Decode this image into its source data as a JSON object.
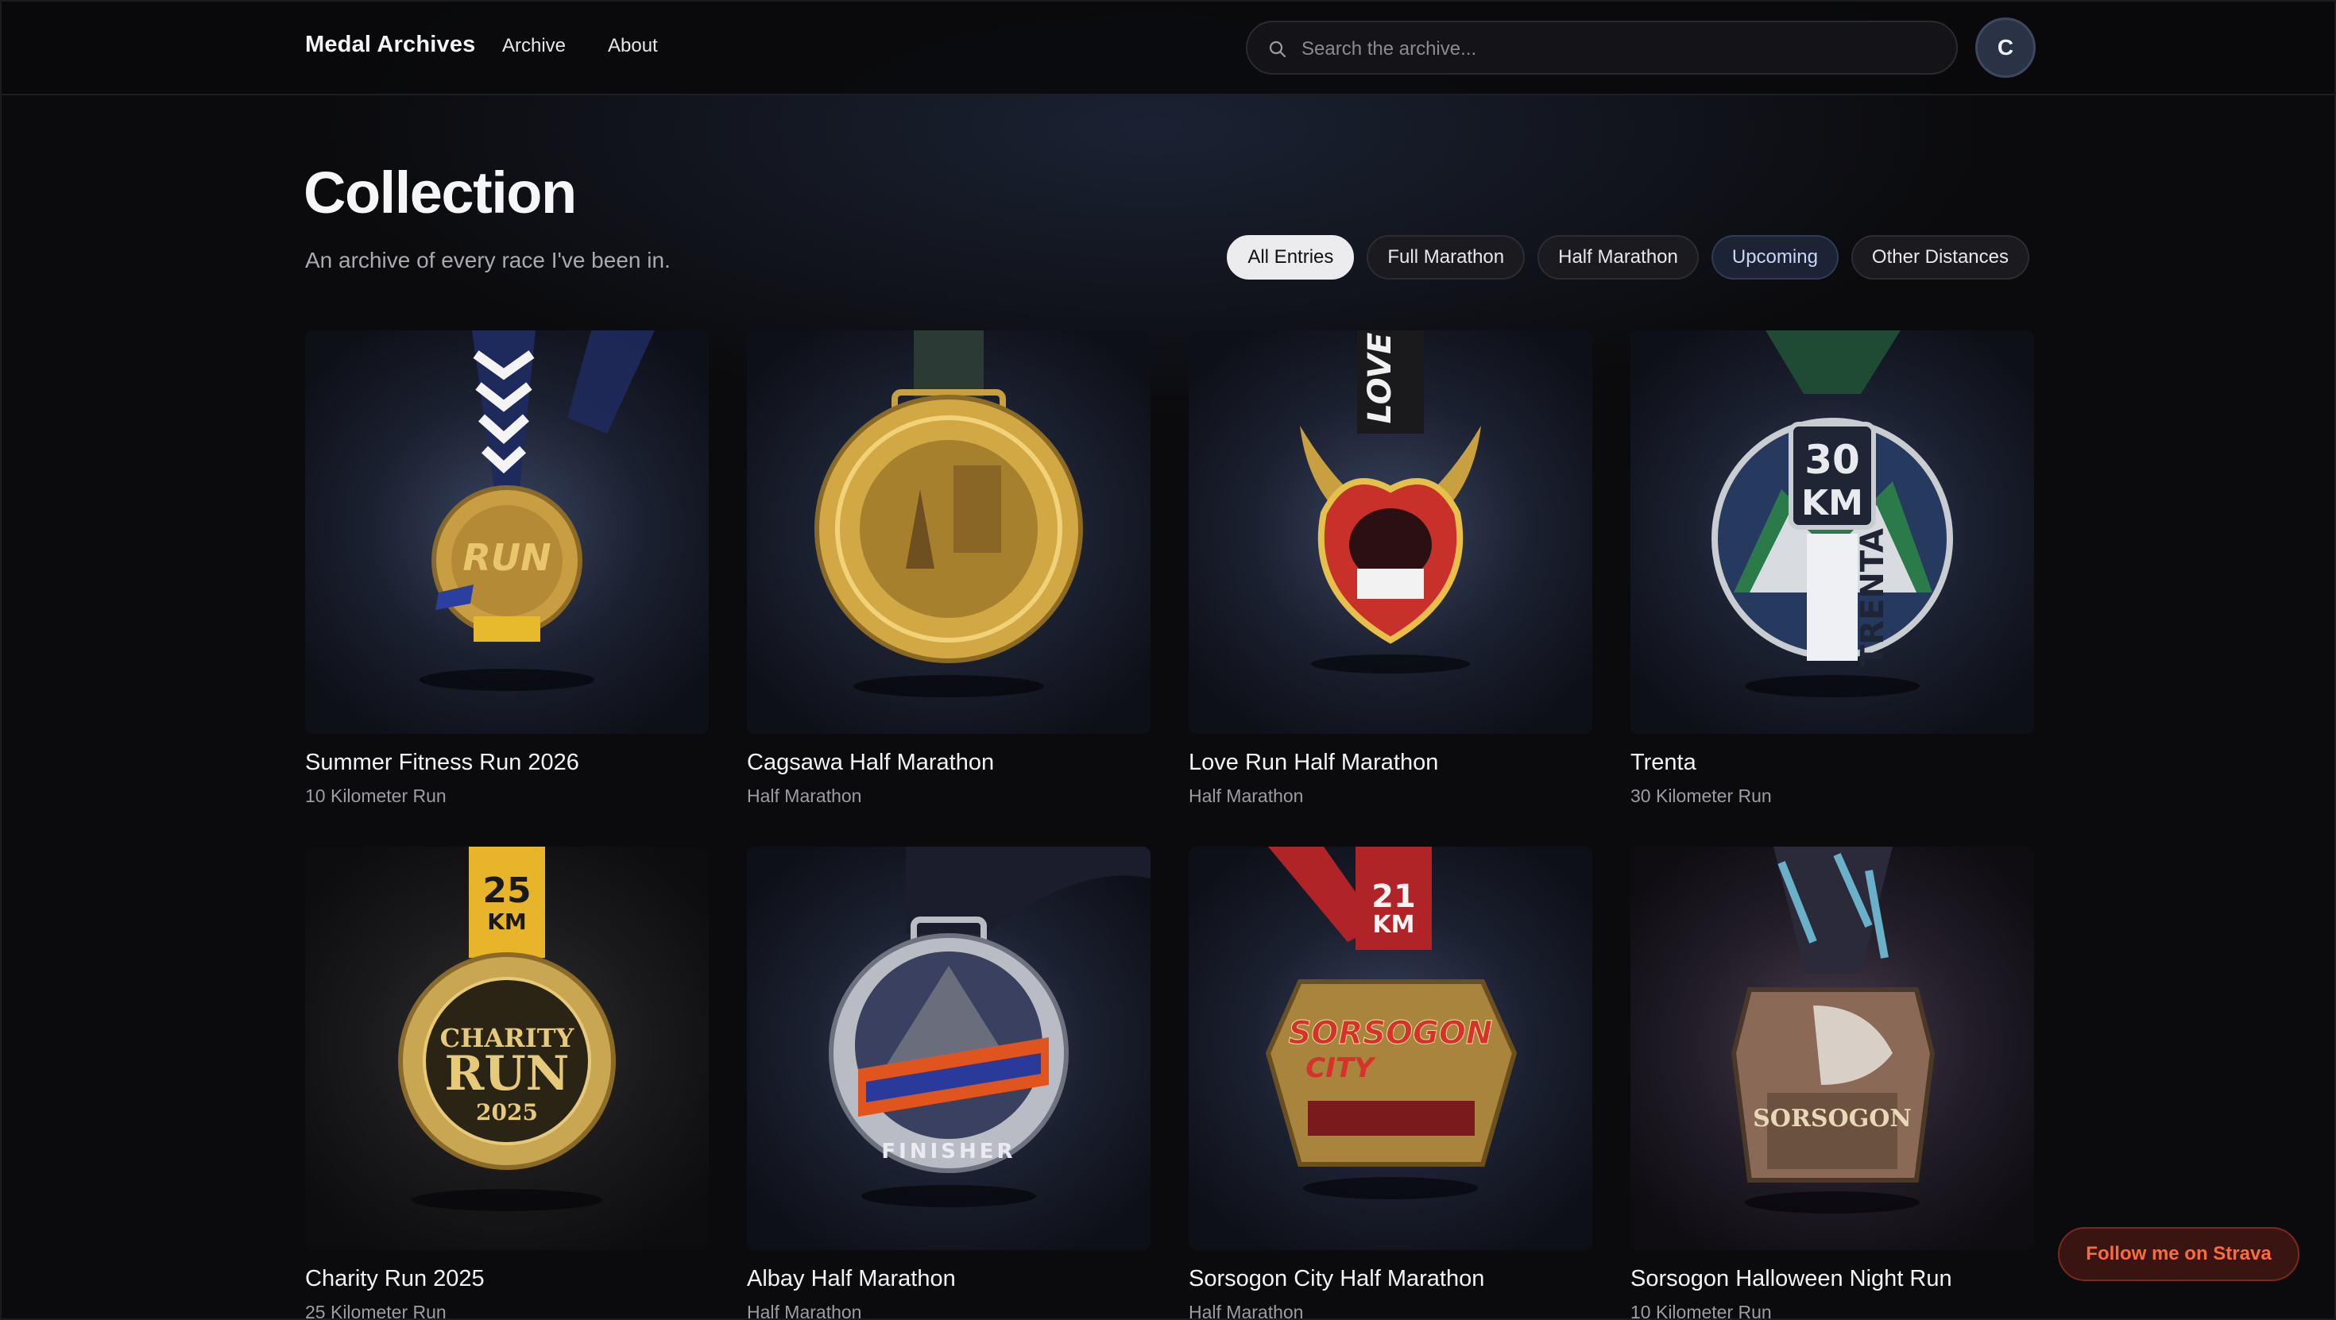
{
  "header": {
    "brand": "Medal Archives",
    "nav": [
      {
        "label": "Archive"
      },
      {
        "label": "About"
      }
    ],
    "search": {
      "placeholder": "Search the archive..."
    },
    "avatar_initial": "C"
  },
  "heading": {
    "title": "Collection",
    "subtitle": "An archive of every race I've been in."
  },
  "filters": [
    {
      "label": "All Entries",
      "active": true
    },
    {
      "label": "Full Marathon",
      "active": false
    },
    {
      "label": "Half Marathon",
      "active": false
    },
    {
      "label": "Upcoming",
      "active": false
    },
    {
      "label": "Other Distances",
      "active": false
    }
  ],
  "medals": [
    {
      "title": "Summer Fitness Run 2026",
      "category": "10 Kilometer Run",
      "icon": "medal-summer-fitness-run",
      "medal_color": "#d4a94a",
      "ribbon_color": "#1f2a5c"
    },
    {
      "title": "Cagsawa Half Marathon",
      "category": "Half Marathon",
      "icon": "medal-cagsawa",
      "medal_color": "#caa040",
      "ribbon_color": "#2c3a36"
    },
    {
      "title": "Love Run Half Marathon",
      "category": "Half Marathon",
      "icon": "medal-love-run",
      "medal_color": "#c8302a",
      "ribbon_color": "#1a1a1d"
    },
    {
      "title": "Trenta",
      "category": "30 Kilometer Run",
      "icon": "medal-trenta",
      "medal_color": "#c9ccd1",
      "ribbon_color": "#1f4a33"
    },
    {
      "title": "Charity Run 2025",
      "category": "25 Kilometer Run",
      "icon": "medal-charity-run",
      "medal_color": "#c9a652",
      "ribbon_color": "#e8b52a"
    },
    {
      "title": "Albay Half Marathon",
      "category": "Half Marathon",
      "icon": "medal-albay",
      "medal_color": "#b9bcc4",
      "ribbon_color": "#1b1d2c"
    },
    {
      "title": "Sorsogon City Half Marathon",
      "category": "Half Marathon",
      "icon": "medal-sorsogon-city",
      "medal_color": "#a8843c",
      "ribbon_color": "#b02428"
    },
    {
      "title": "Sorsogon Halloween Night Run",
      "category": "10 Kilometer Run",
      "icon": "medal-sorsogon-halloween",
      "medal_color": "#8a6a56",
      "ribbon_color": "#2b2a3a"
    }
  ],
  "medal_text": {
    "summer": "RUN",
    "love": "LOVE",
    "trenta_km": "30",
    "trenta_unit": "KM",
    "trenta_name": "TRENTA",
    "charity_km": "25",
    "charity_unit": "KM",
    "charity_word": "CHARITY",
    "charity_run": "RUN",
    "charity_year": "2025",
    "albay_finisher": "FINISHER",
    "sorsogon_km": "21",
    "sorsogon_unit": "KM",
    "sorsogon_name": "SORSOGON",
    "sorsogon_city": "CITY",
    "halloween_name": "SORSOGON"
  },
  "strava": {
    "label": "Follow me on Strava"
  }
}
